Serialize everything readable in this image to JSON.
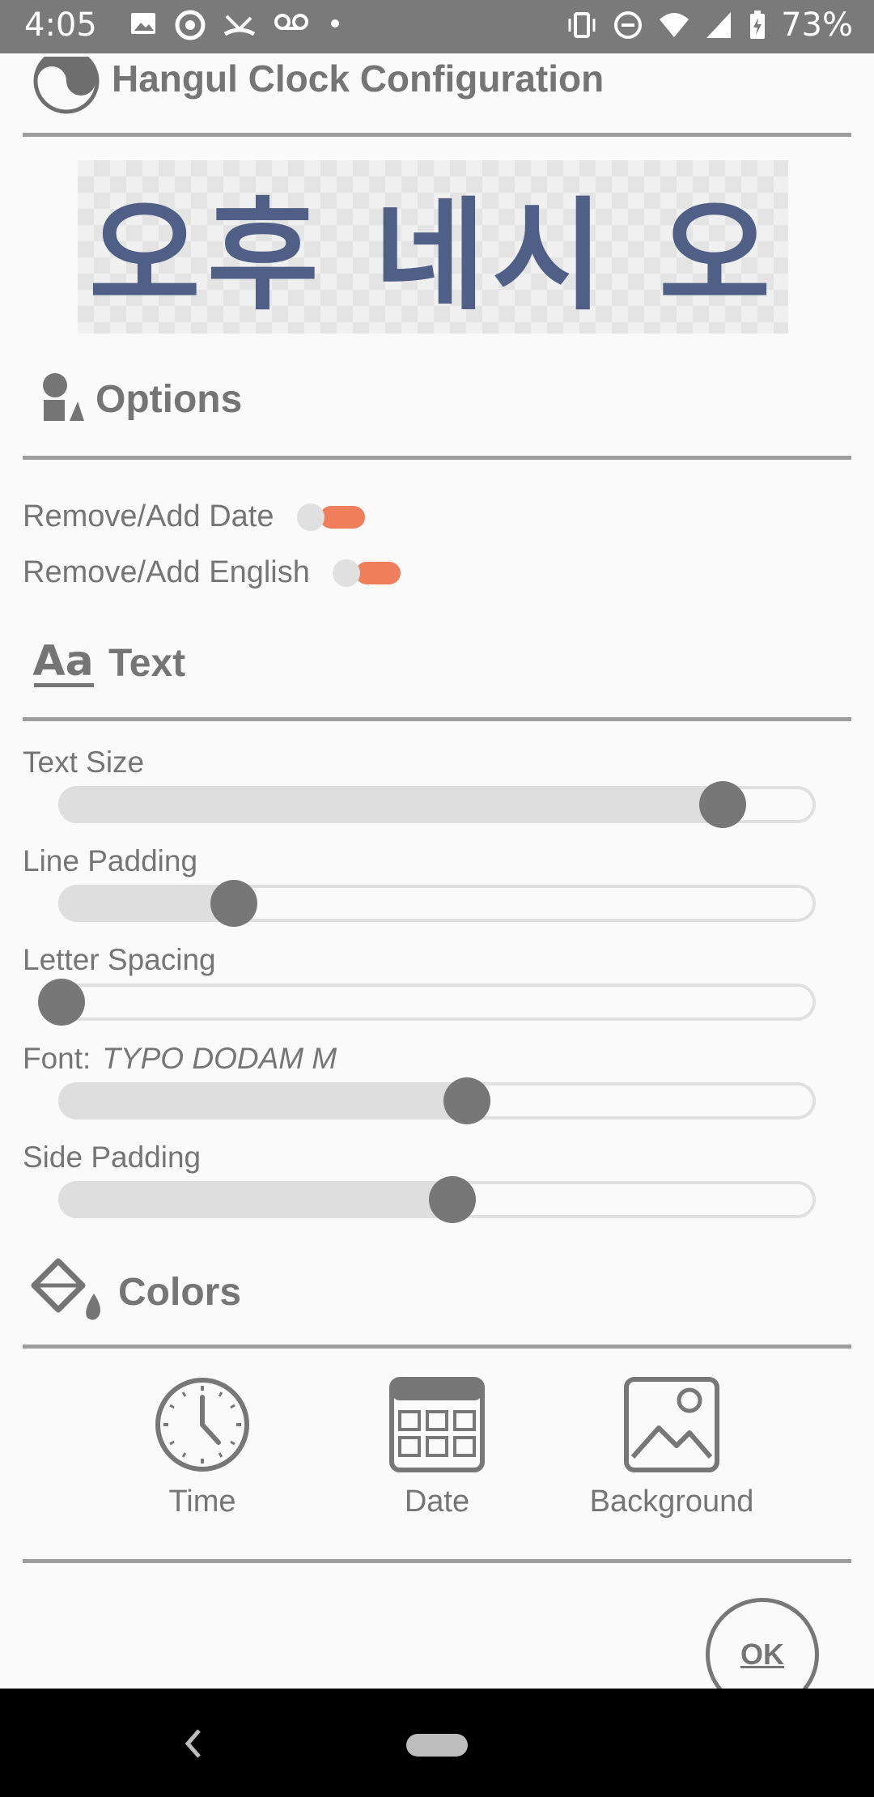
{
  "status_bar": {
    "time": "4:05",
    "battery": "73%"
  },
  "header": {
    "title": "Hangul Clock Configuration"
  },
  "preview": {
    "clock_text": "오후 네시 오",
    "text_color": "#4f5f85"
  },
  "options": {
    "title": "Options",
    "toggles": [
      {
        "label": "Remove/Add Date",
        "on": true
      },
      {
        "label": "Remove/Add English",
        "on": true
      }
    ]
  },
  "text_section": {
    "title": "Text",
    "sliders": [
      {
        "label": "Text Size",
        "fraction": 0.88
      },
      {
        "label": "Line Padding",
        "fraction": 0.23
      },
      {
        "label": "Letter Spacing",
        "fraction": 0.0
      },
      {
        "label": "Font:",
        "value": "TYPO DODAM M",
        "fraction": 0.54
      },
      {
        "label": "Side Padding",
        "fraction": 0.52
      }
    ]
  },
  "colors": {
    "title": "Colors",
    "buttons": [
      {
        "label": "Time",
        "icon": "clock-icon"
      },
      {
        "label": "Date",
        "icon": "calendar-icon"
      },
      {
        "label": "Background",
        "icon": "image-icon"
      }
    ]
  },
  "ok_label": "OK",
  "accent_color": "#ef7f5c"
}
